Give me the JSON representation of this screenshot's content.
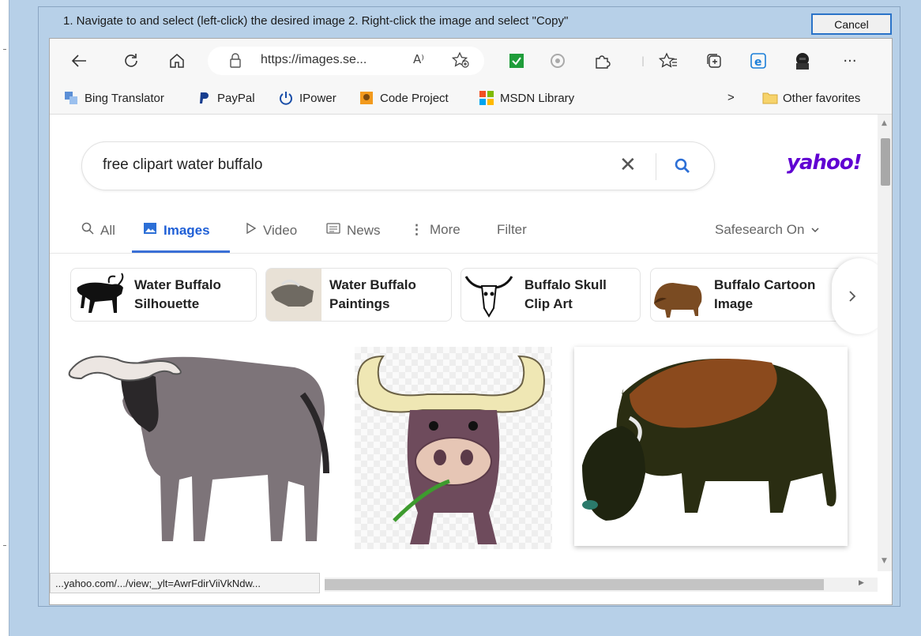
{
  "dialog": {
    "instructions": "1. Navigate to and select (left-click) the desired image  2. Right-click the image and select \"Copy\"",
    "cancel_label": "Cancel"
  },
  "browser": {
    "url": "https://images.se...",
    "read_aloud": "A⁾",
    "more_label": "···"
  },
  "favorites": {
    "items": [
      {
        "label": "Bing Translator"
      },
      {
        "label": "PayPal"
      },
      {
        "label": "IPower"
      },
      {
        "label": "Code Project"
      },
      {
        "label": "MSDN Library"
      }
    ],
    "overflow": ">",
    "other": "Other favorites"
  },
  "search": {
    "query": "free clipart water buffalo",
    "clear": "✕"
  },
  "brand": {
    "logo": "yahoo!"
  },
  "tabs": {
    "all": "All",
    "images": "Images",
    "video": "Video",
    "news": "News",
    "more": "More",
    "filter": "Filter",
    "safesearch": "Safesearch On"
  },
  "related": [
    {
      "line1": "Water Buffalo",
      "line2": "Silhouette"
    },
    {
      "line1": "Water Buffalo",
      "line2": "Paintings"
    },
    {
      "line1": "Buffalo Skull",
      "line2": "Clip Art"
    },
    {
      "line1": "Buffalo Cartoon",
      "line2": "Image"
    }
  ],
  "status": {
    "link": "...yahoo.com/.../view;_ylt=AwrFdirViiVkNdw..."
  },
  "colors": {
    "accent": "#6001d2",
    "tab_active": "#1f5fd6",
    "frame": "#b7d0e8"
  }
}
